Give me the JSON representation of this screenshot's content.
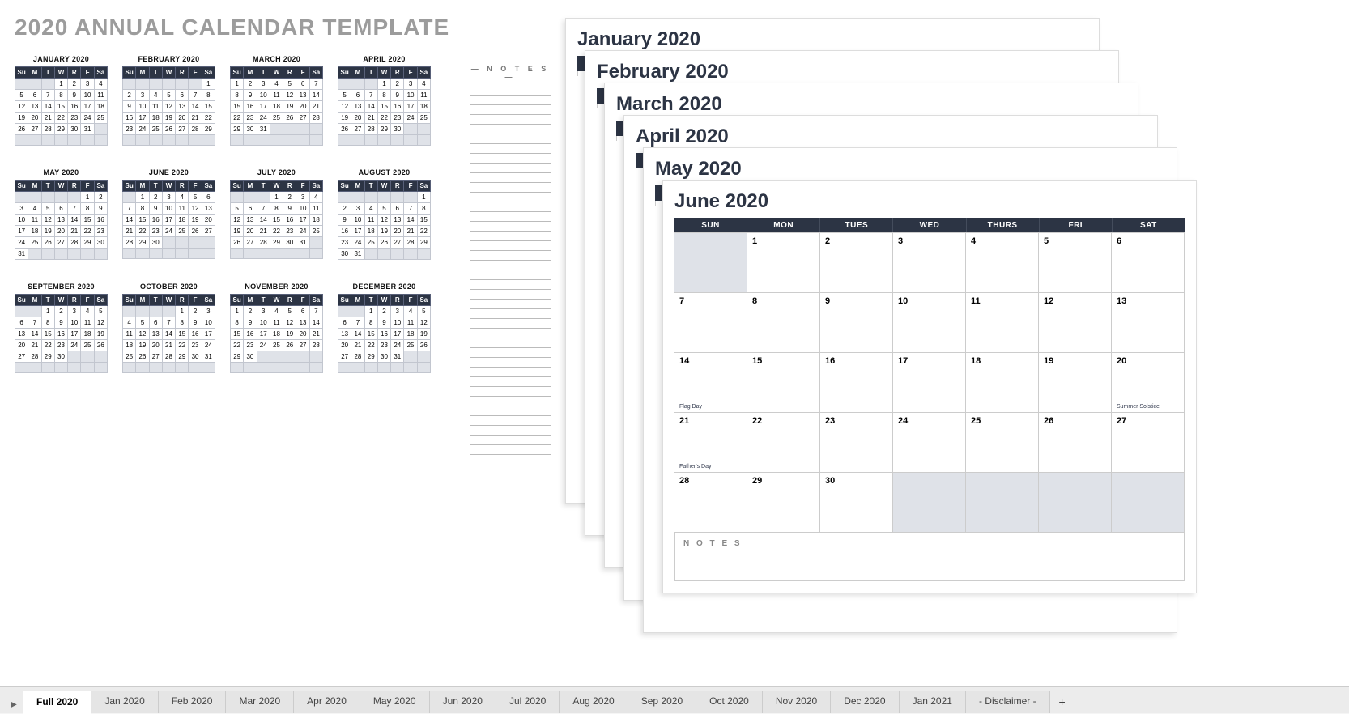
{
  "title": "2020 ANNUAL CALENDAR TEMPLATE",
  "dow_short": [
    "Su",
    "M",
    "T",
    "W",
    "R",
    "F",
    "Sa"
  ],
  "dow_long": [
    "SUN",
    "MON",
    "TUES",
    "WED",
    "THURS",
    "FRI",
    "SAT"
  ],
  "mini_notes_title": "— N O T E S —",
  "mini_months": [
    {
      "name": "JANUARY 2020",
      "start": 3,
      "days": 31
    },
    {
      "name": "FEBRUARY 2020",
      "start": 6,
      "days": 29
    },
    {
      "name": "MARCH 2020",
      "start": 0,
      "days": 31
    },
    {
      "name": "APRIL 2020",
      "start": 3,
      "days": 30
    },
    {
      "name": "MAY 2020",
      "start": 5,
      "days": 31
    },
    {
      "name": "JUNE 2020",
      "start": 1,
      "days": 30
    },
    {
      "name": "JULY 2020",
      "start": 3,
      "days": 31
    },
    {
      "name": "AUGUST 2020",
      "start": 6,
      "days": 31
    },
    {
      "name": "SEPTEMBER 2020",
      "start": 2,
      "days": 30
    },
    {
      "name": "OCTOBER 2020",
      "start": 4,
      "days": 31
    },
    {
      "name": "NOVEMBER 2020",
      "start": 0,
      "days": 30
    },
    {
      "name": "DECEMBER 2020",
      "start": 2,
      "days": 31
    }
  ],
  "stack": [
    {
      "title": "January 2020"
    },
    {
      "title": "February 2020"
    },
    {
      "title": "March 2020"
    },
    {
      "title": "April 2020"
    },
    {
      "title": "May 2020"
    }
  ],
  "front": {
    "title": "June 2020",
    "start": 1,
    "days": 30,
    "events": {
      "14": "Flag Day",
      "20": "Summer Solstice",
      "21": "Father's Day"
    },
    "notes_label": "N O T E S"
  },
  "tabs": {
    "active": "Full 2020",
    "items": [
      "Full 2020",
      "Jan 2020",
      "Feb 2020",
      "Mar 2020",
      "Apr 2020",
      "May 2020",
      "Jun 2020",
      "Jul 2020",
      "Aug 2020",
      "Sep 2020",
      "Oct 2020",
      "Nov 2020",
      "Dec 2020",
      "Jan 2021",
      "- Disclaimer -"
    ]
  }
}
